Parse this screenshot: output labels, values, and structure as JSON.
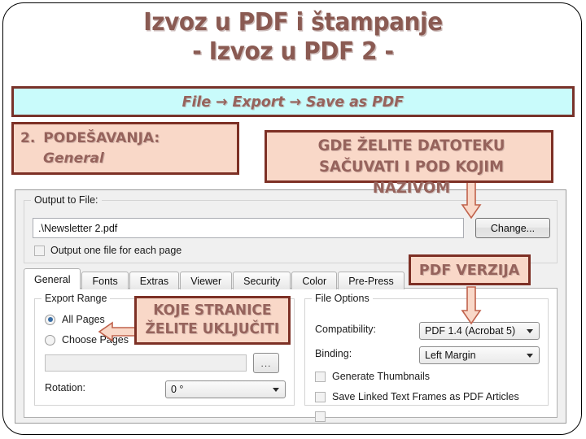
{
  "slide": {
    "title_line1": "Izvoz u PDF i štampanje",
    "title_line2": "- Izvoz u PDF 2 -"
  },
  "banner": {
    "text": "File → Export → Save as PDF",
    "bg": "#c9fbfb",
    "border": "#78322a",
    "text_color": "#96635c"
  },
  "callouts": {
    "settings": {
      "number": "2.",
      "line1": "PODEŠAVANJA:",
      "line2": "General"
    },
    "where_to_save": {
      "line1": "GDE ŽELITE DATOTEKU",
      "line2": "SAČUVATI I POD KOJIM",
      "line3": "NAZIVOM"
    },
    "pdf_version": {
      "label": "PDF VERZIJA"
    },
    "which_pages": {
      "line1": "KOJE STRANICE",
      "line2": "ŽELITE UKLJUČITI"
    },
    "style": {
      "bg": "#f9d8c8",
      "border": "#7d3025",
      "text_color": "#96635c"
    }
  },
  "arrows": {
    "to_change_button": "arrow-down",
    "to_compatibility": "arrow-down",
    "to_all_pages": "arrow-left"
  },
  "dialog": {
    "output_group": {
      "label": "Output to File:",
      "file_value": ".\\Newsletter 2.pdf",
      "change_button": "Change...",
      "checkbox_label": "Output one file for each page",
      "checkbox_checked": false
    },
    "tabs": [
      {
        "label": "General",
        "active": true
      },
      {
        "label": "Fonts",
        "active": false
      },
      {
        "label": "Extras",
        "active": false
      },
      {
        "label": "Viewer",
        "active": false
      },
      {
        "label": "Security",
        "active": false
      },
      {
        "label": "Color",
        "active": false
      },
      {
        "label": "Pre-Press",
        "active": false
      }
    ],
    "export_range": {
      "label": "Export Range",
      "radio_all_pages": "All Pages",
      "radio_all_pages_selected": true,
      "radio_choose_pages": "Choose Pages",
      "radio_choose_pages_selected": false,
      "pages_input_value": "",
      "browse_button": "...",
      "rotation_label": "Rotation:",
      "rotation_value": "0 °"
    },
    "file_options": {
      "label": "File Options",
      "compatibility_label": "Compatibility:",
      "compatibility_value": "PDF 1.4 (Acrobat 5)",
      "binding_label": "Binding:",
      "binding_value": "Left Margin",
      "checkbox_thumbnails": "Generate Thumbnails",
      "checkbox_thumbnails_checked": false,
      "checkbox_linked_frames": "Save Linked Text Frames as PDF Articles",
      "checkbox_linked_frames_checked": false
    }
  }
}
